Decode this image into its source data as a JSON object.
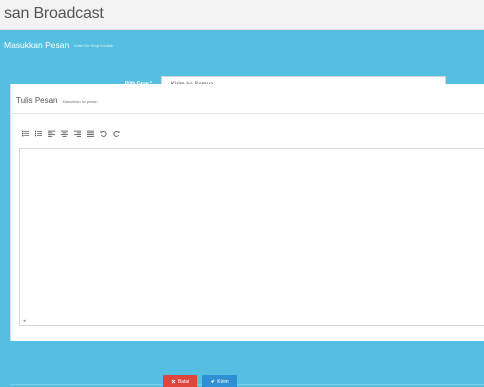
{
  "page": {
    "title": "san Broadcast"
  },
  "panel": {
    "title": "Masukkan Pesan",
    "subtitle": "Kirim Ke Grup Kontak"
  },
  "group": {
    "label": "Pilih Grup *",
    "selected": "Kirim ke Semua"
  },
  "editor": {
    "title": "Tulis Pesan",
    "subtitle": "Masukkan isi pesan",
    "toolbar": [
      {
        "name": "unordered-list-icon"
      },
      {
        "name": "ordered-list-icon"
      },
      {
        "name": "align-left-icon"
      },
      {
        "name": "align-center-icon"
      },
      {
        "name": "align-right-icon"
      },
      {
        "name": "justify-icon"
      },
      {
        "name": "undo-icon"
      },
      {
        "name": "redo-icon"
      }
    ],
    "content": ""
  },
  "actions": {
    "cancel_label": "Batal",
    "send_label": "Kirim"
  },
  "colors": {
    "panel": "#54bfe0",
    "cancel": "#e0453c",
    "send": "#2f8fd5"
  }
}
